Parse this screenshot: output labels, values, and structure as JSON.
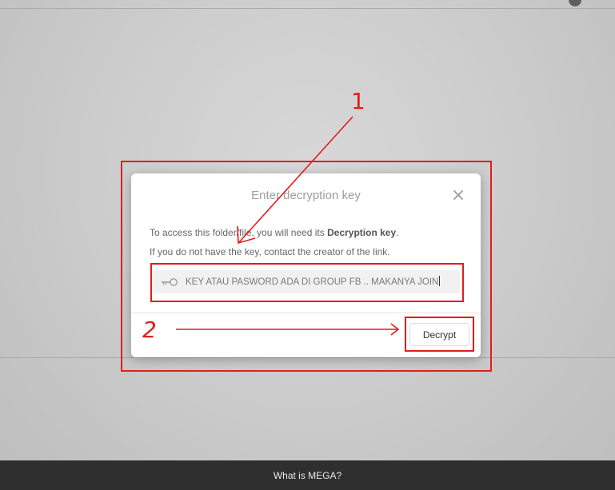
{
  "dialog": {
    "title": "Enter decryption key",
    "desc_line1_prefix": "To access this folder/file, you will need its ",
    "desc_line1_bold": "Decryption key",
    "desc_line1_suffix": ".",
    "desc_line2": "If you do not have the key, contact the creator of the link.",
    "key_input_value": "KEY ATAU PASWORD ADA DI GROUP FB .. MAKANYA JOIN",
    "decrypt_label": "Decrypt"
  },
  "annotations": {
    "label_1": "1",
    "label_2": "2",
    "color": "#e31c1c"
  },
  "footer": {
    "link_label": "What is MEGA?"
  },
  "icons": {
    "close": "close-icon",
    "key": "key-icon"
  },
  "colors": {
    "background": "#cdcdcd",
    "footer": "#2f2f2f",
    "title": "#9d9d9d",
    "input_bg": "#f1f1f1"
  }
}
